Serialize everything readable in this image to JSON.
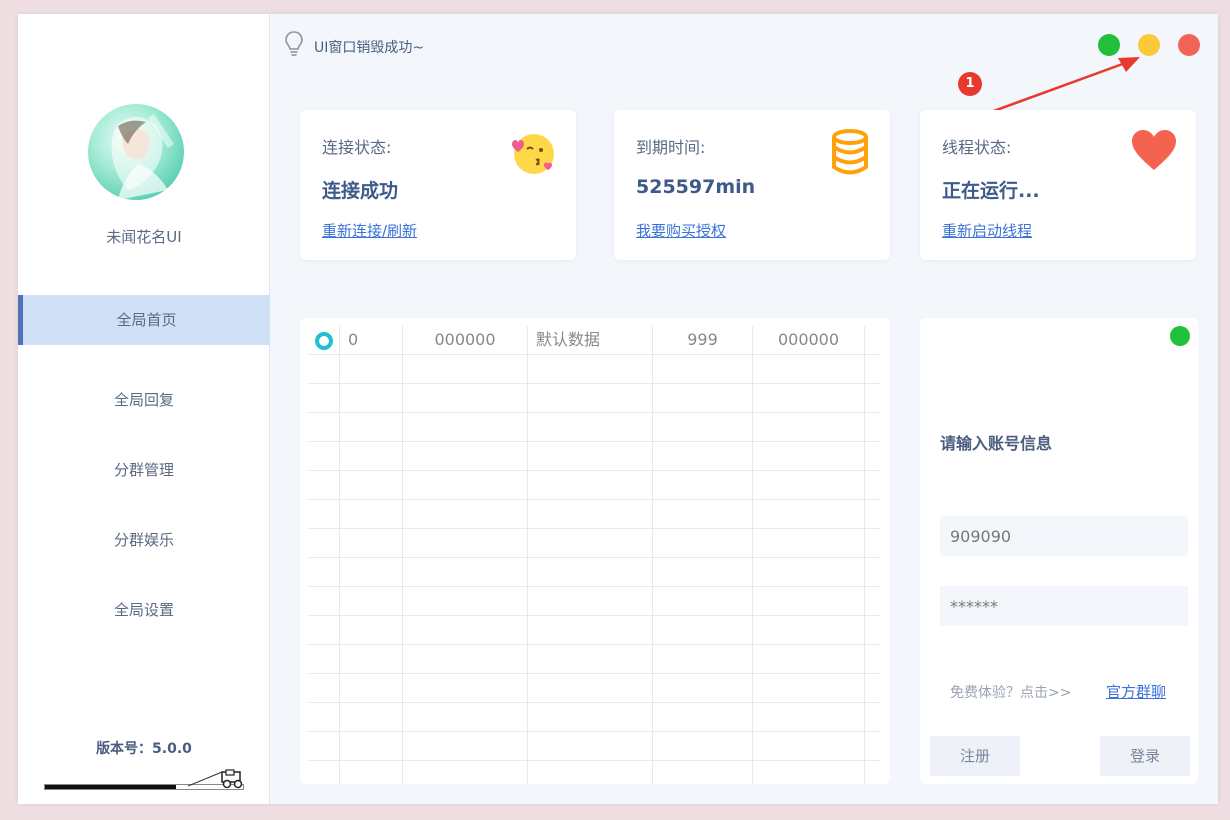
{
  "topbar": {
    "title": "UI窗口销毁成功~",
    "icon": "lightbulb-icon",
    "window_dots": [
      {
        "name": "maximize-dot",
        "color": "#22c03a"
      },
      {
        "name": "minimize-dot",
        "color": "#fcc93a"
      },
      {
        "name": "close-dot",
        "color": "#f2645a"
      }
    ],
    "annotation_badge": "1"
  },
  "sidebar": {
    "brand": "未闻花名UI",
    "items": [
      {
        "label": "全局首页",
        "active": true
      },
      {
        "label": "全局回复",
        "active": false
      },
      {
        "label": "分群管理",
        "active": false
      },
      {
        "label": "分群娱乐",
        "active": false
      },
      {
        "label": "全局设置",
        "active": false
      }
    ],
    "version": "版本号：5.0.0"
  },
  "cards": [
    {
      "label": "连接状态:",
      "value": "连接成功",
      "link": "重新连接/刷新",
      "icon": "kiss-emoji-icon"
    },
    {
      "label": "到期时间:",
      "value": "525597min",
      "link": "我要购买授权",
      "icon": "database-icon"
    },
    {
      "label": "线程状态:",
      "value": "正在运行...",
      "link": "重新启动线程",
      "icon": "heart-icon"
    }
  ],
  "table": {
    "rows": [
      [
        "0",
        "000000",
        "默认数据",
        "999",
        "000000"
      ]
    ]
  },
  "login": {
    "title": "请输入账号信息",
    "account_value": "909090",
    "password_value": "******",
    "trial_text": "免费体验？点击>>",
    "group_link": "官方群聊",
    "register_label": "注册",
    "login_label": "登录"
  },
  "colors": {
    "accent": "#4f73b5",
    "link": "#3a72d6",
    "radio": "#1fc1d1"
  }
}
